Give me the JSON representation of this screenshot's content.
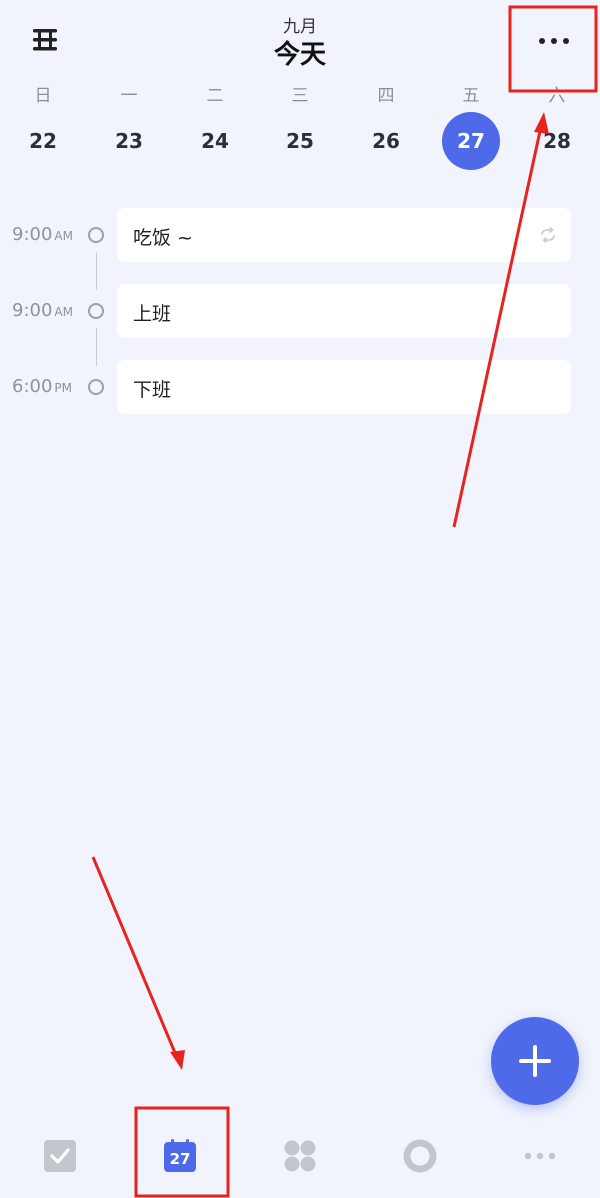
{
  "header": {
    "month": "九月",
    "title": "今天"
  },
  "week": {
    "days": [
      {
        "weekday": "日",
        "date": "22"
      },
      {
        "weekday": "一",
        "date": "23"
      },
      {
        "weekday": "二",
        "date": "24"
      },
      {
        "weekday": "三",
        "date": "25"
      },
      {
        "weekday": "四",
        "date": "26"
      },
      {
        "weekday": "五",
        "date": "27",
        "selected": true
      },
      {
        "weekday": "六",
        "date": "28"
      }
    ]
  },
  "events": [
    {
      "time": "9:00",
      "ampm": "AM",
      "title": "吃饭 ~",
      "repeat": true,
      "icon": "repeat-icon"
    },
    {
      "time": "9:00",
      "ampm": "AM",
      "title": "上班",
      "repeat": false
    },
    {
      "time": "6:00",
      "ampm": "PM",
      "title": "下班",
      "repeat": false
    }
  ],
  "tabbar": {
    "tabs": [
      {
        "name": "tasks",
        "icon": "checkbox-icon"
      },
      {
        "name": "calendar",
        "icon": "calendar-icon",
        "label": "27",
        "active": true
      },
      {
        "name": "grid",
        "icon": "grid-icon"
      },
      {
        "name": "focus",
        "icon": "focus-ring-icon"
      },
      {
        "name": "more",
        "icon": "more-dots-icon"
      }
    ]
  },
  "colors": {
    "accent": "#4e6ae8",
    "background": "#f1f4fc",
    "annotation": "#e8221c"
  }
}
